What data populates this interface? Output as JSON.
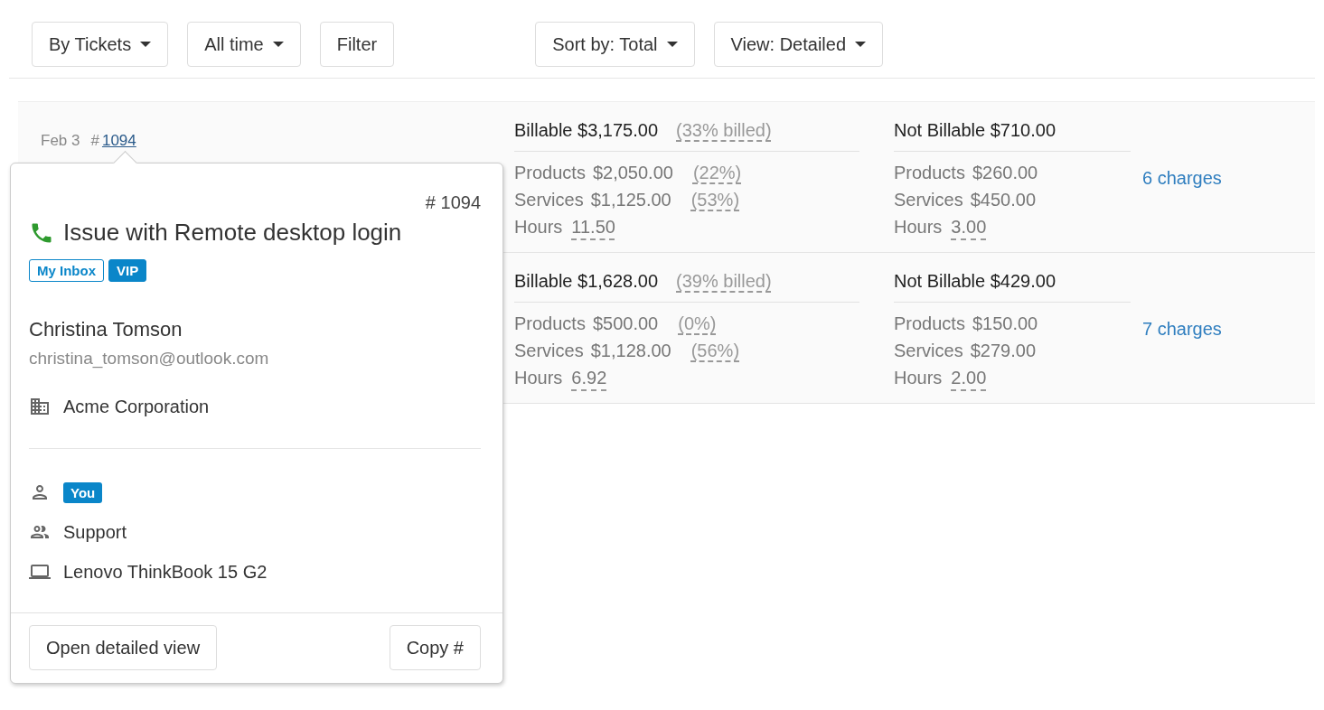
{
  "toolbar_left": [
    {
      "label": "By Tickets",
      "kind": "dropdown"
    },
    {
      "label": "All time",
      "kind": "dropdown"
    },
    {
      "label": "Filter",
      "kind": "button"
    }
  ],
  "toolbar_right": [
    {
      "label": "Sort by: Total",
      "kind": "dropdown"
    },
    {
      "label": "View: Detailed",
      "kind": "dropdown"
    }
  ],
  "rows": [
    {
      "date": "Feb 3",
      "number_prefix": "#",
      "number": "1094",
      "billable": {
        "label": "Billable",
        "amount": "$3,175.00",
        "note": "(33% billed)",
        "lines": [
          {
            "label": "Products",
            "amount": "$2,050.00",
            "percent": "(22%)"
          },
          {
            "label": "Services",
            "amount": "$1,125.00",
            "percent": "(53%)"
          }
        ],
        "hours": {
          "label": "Hours",
          "value": "11.50"
        }
      },
      "not_billable": {
        "label": "Not Billable",
        "amount": "$710.00",
        "lines": [
          {
            "label": "Products",
            "amount": "$260.00"
          },
          {
            "label": "Services",
            "amount": "$450.00"
          }
        ],
        "hours": {
          "label": "Hours",
          "value": "3.00"
        }
      },
      "charges": "6 charges"
    },
    {
      "billable": {
        "label": "Billable",
        "amount": "$1,628.00",
        "note": "(39% billed)",
        "lines": [
          {
            "label": "Products",
            "amount": "$500.00",
            "percent": "(0%)"
          },
          {
            "label": "Services",
            "amount": "$1,128.00",
            "percent": "(56%)"
          }
        ],
        "hours": {
          "label": "Hours",
          "value": "6.92"
        }
      },
      "not_billable": {
        "label": "Not Billable",
        "amount": "$429.00",
        "lines": [
          {
            "label": "Products",
            "amount": "$150.00"
          },
          {
            "label": "Services",
            "amount": "$279.00"
          }
        ],
        "hours": {
          "label": "Hours",
          "value": "2.00"
        }
      },
      "charges": "7 charges"
    }
  ],
  "popover": {
    "number": "# 1094",
    "title": "Issue with Remote desktop login",
    "tags": [
      {
        "label": "My Inbox",
        "kind": "outline"
      },
      {
        "label": "VIP",
        "kind": "solid"
      }
    ],
    "contact_name": "Christina Tomson",
    "contact_email": "christina_tomson@outlook.com",
    "details": [
      {
        "kind": "company",
        "text": "Acme Corporation"
      }
    ],
    "assignment": [
      {
        "kind": "assignee",
        "text": "You"
      },
      {
        "kind": "group",
        "text": "Support"
      },
      {
        "kind": "device",
        "text": "Lenovo ThinkBook 15 G2"
      }
    ],
    "buttons": [
      "Open detailed view",
      "Copy #"
    ]
  }
}
